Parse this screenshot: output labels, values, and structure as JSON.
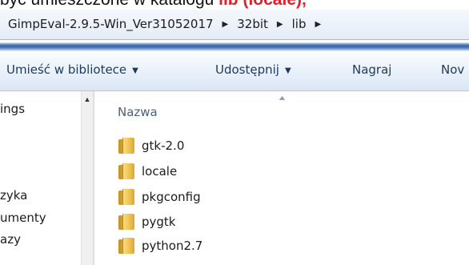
{
  "caption": {
    "prefix": "być umieszczone w katalogu ",
    "highlight": "lib (locale),"
  },
  "address_bar": {
    "crumbs": [
      "GimpEval-2.9.5-Win_Ver31052017",
      "32bit",
      "lib"
    ]
  },
  "toolbar": {
    "library_label": "Umieść w bibliotece",
    "share_label": "Udostępnij",
    "burn_label": "Nagraj",
    "new_label": "Nov"
  },
  "nav_pane": {
    "items": [
      "ings",
      "zyka",
      "umenty",
      "azy"
    ]
  },
  "column_header": {
    "name": "Nazwa"
  },
  "files": [
    {
      "name": "gtk-2.0",
      "icon": "folder-icon"
    },
    {
      "name": "locale",
      "icon": "folder-icon"
    },
    {
      "name": "pkgconfig",
      "icon": "folder-icon"
    },
    {
      "name": "pygtk",
      "icon": "folder-icon"
    },
    {
      "name": "python2.7",
      "icon": "folder-icon"
    }
  ],
  "colors": {
    "highlight": "#e0202a",
    "toolbar_text": "#1e395b",
    "header_text": "#4c607a",
    "frame_accent": "#2e62ad"
  }
}
